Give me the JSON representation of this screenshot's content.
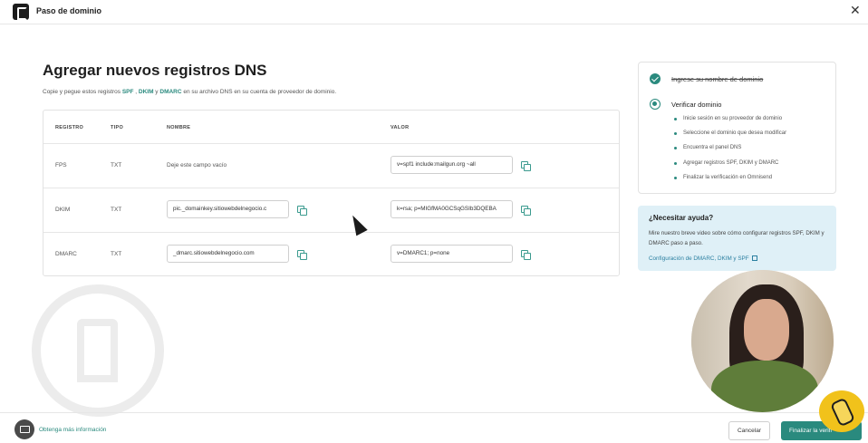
{
  "window": {
    "title": "Paso de dominio"
  },
  "main": {
    "heading": "Agregar nuevos registros DNS",
    "subtitle": {
      "before": "Copie y pegue estos registros ",
      "spf": "SPF",
      "sep1": " , ",
      "dkim": "DKIM",
      "sep2": " y ",
      "dmarc": "DMARC",
      "after": " en su archivo DNS en su cuenta de proveedor de dominio."
    }
  },
  "table": {
    "headers": {
      "registro": "REGISTRO",
      "tipo": "TIPO",
      "nombre": "NOMBRE",
      "valor": "VALOR"
    },
    "rows": [
      {
        "registro": "FPS",
        "tipo": "TXT",
        "nombre": "Deje este campo vacío",
        "valor": "v=spf1 include:mailgun.org ~all"
      },
      {
        "registro": "DKIM",
        "tipo": "TXT",
        "nombre": "pic._domainkey.sitiowebdelnegocio.c",
        "valor": "k=rsa; p=MIGfMA0GCSqGSIb3DQEBA"
      },
      {
        "registro": "DMARC",
        "tipo": "TXT",
        "nombre": "_dmarc.sitiowebdelnegocio.com",
        "valor": "v=DMARC1; p=none"
      }
    ]
  },
  "steps": {
    "step1": "Ingrese su nombre de dominio",
    "step2": "Verificar dominio",
    "substeps": [
      "Inicie sesión en su proveedor de dominio",
      "Seleccione el dominio que desea modificar",
      "Encuentra el panel DNS",
      "Agregar registros SPF, DKIM y DMARC",
      "Finalizar la verificación en Omnisend"
    ]
  },
  "help": {
    "title": "¿Necesitar ayuda?",
    "text": "Mire nuestro breve video sobre cómo configurar registros SPF, DKIM y DMARC paso a paso.",
    "link": "Configuración de DMARC, DKIM y SPF"
  },
  "footer": {
    "more_info": "Obtenga más información",
    "cancel": "Cancelar",
    "finish": "Finalizar la verifi"
  },
  "colors": {
    "accent": "#2a8a7e",
    "help_bg": "#dff0f7",
    "hand_badge": "#f1c21b"
  },
  "icons": [
    "logo-icon",
    "close-icon",
    "copy-icon",
    "check-icon",
    "radio-icon",
    "external-link-icon",
    "chat-icon",
    "pointing-hand-icon"
  ]
}
